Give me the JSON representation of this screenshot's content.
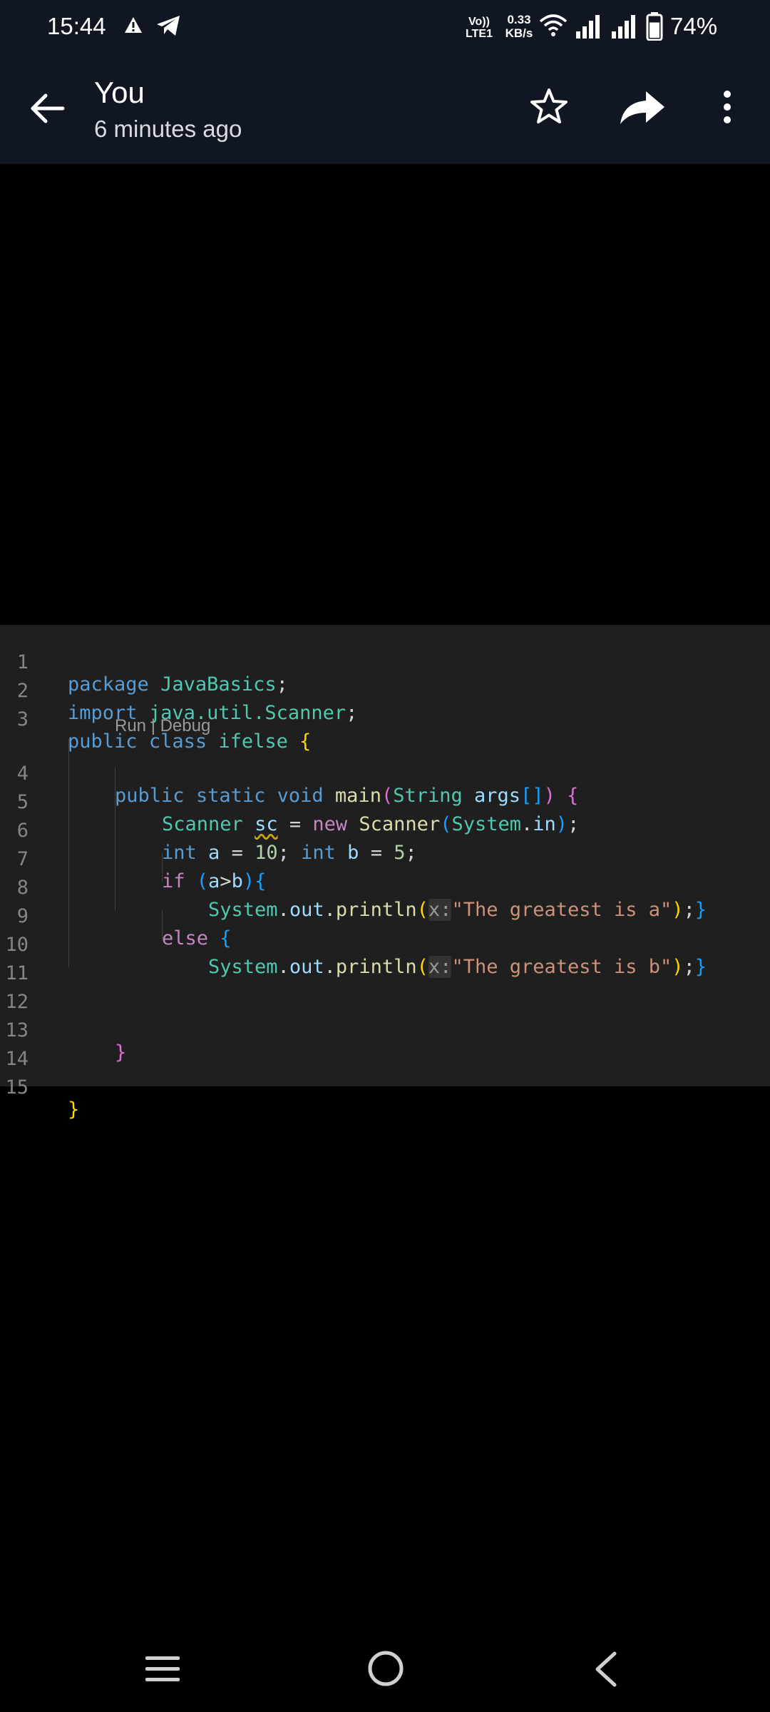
{
  "status_bar": {
    "time": "15:44",
    "network_label_top": "Vo))",
    "network_label_bottom": "LTE1",
    "speed_value": "0.33",
    "speed_unit": "KB/s",
    "battery_percent": "74%",
    "battery_level": 0.74,
    "icons": [
      "alert-icon",
      "telegram-icon",
      "wifi-icon",
      "signal-icon",
      "signal-icon",
      "battery-icon"
    ]
  },
  "app_bar": {
    "title": "You",
    "subtitle": "6 minutes ago",
    "icons": [
      "back-arrow-icon",
      "star-icon",
      "share-icon",
      "more-vert-icon"
    ],
    "icon_color": "#ffffff",
    "background": "#111722"
  },
  "code_image": {
    "background": "#1f1f1f",
    "line_numbers": [
      "1",
      "2",
      "3",
      "4",
      "5",
      "6",
      "7",
      "8",
      "9",
      "10",
      "11",
      "12",
      "13",
      "14",
      "15"
    ],
    "codelens": "Run | Debug",
    "lines": {
      "l1": [
        "package",
        " ",
        "JavaBasics",
        ";"
      ],
      "l2": [
        "import",
        " ",
        "java.util.Scanner",
        ";"
      ],
      "l3": [
        "public",
        " ",
        "class",
        " ",
        "ifelse",
        " ",
        "{"
      ],
      "l4": [
        "public",
        " ",
        "static",
        " ",
        "void",
        " ",
        "main",
        "(",
        "String",
        " ",
        "args",
        "[]",
        ")",
        " ",
        "{"
      ],
      "l5": [
        "Scanner",
        " ",
        "sc",
        " = ",
        "new",
        " ",
        "Scanner",
        "(",
        "System",
        ".",
        "in",
        ")",
        ";"
      ],
      "l6": [
        "int",
        " ",
        "a",
        " = ",
        "10",
        "; ",
        "int",
        " ",
        "b",
        " = ",
        "5",
        ";"
      ],
      "l7": [
        "if",
        " ",
        "(",
        "a",
        ">",
        "b",
        "){"
      ],
      "l8": [
        "System",
        ".",
        "out",
        ".",
        "println",
        "(",
        "x:",
        "\"The greatest is a\"",
        ")",
        ";",
        "}"
      ],
      "l9": [
        "else",
        " ",
        "{"
      ],
      "l10": [
        "System",
        ".",
        "out",
        ".",
        "println",
        "(",
        "x:",
        "\"The greatest is b\"",
        ")",
        ";",
        "}"
      ],
      "l13": [
        "}"
      ],
      "l15": [
        "}"
      ]
    }
  },
  "nav_bar": {
    "icons": [
      "recents-menu-icon",
      "home-circle-icon",
      "back-chevron-icon"
    ]
  }
}
